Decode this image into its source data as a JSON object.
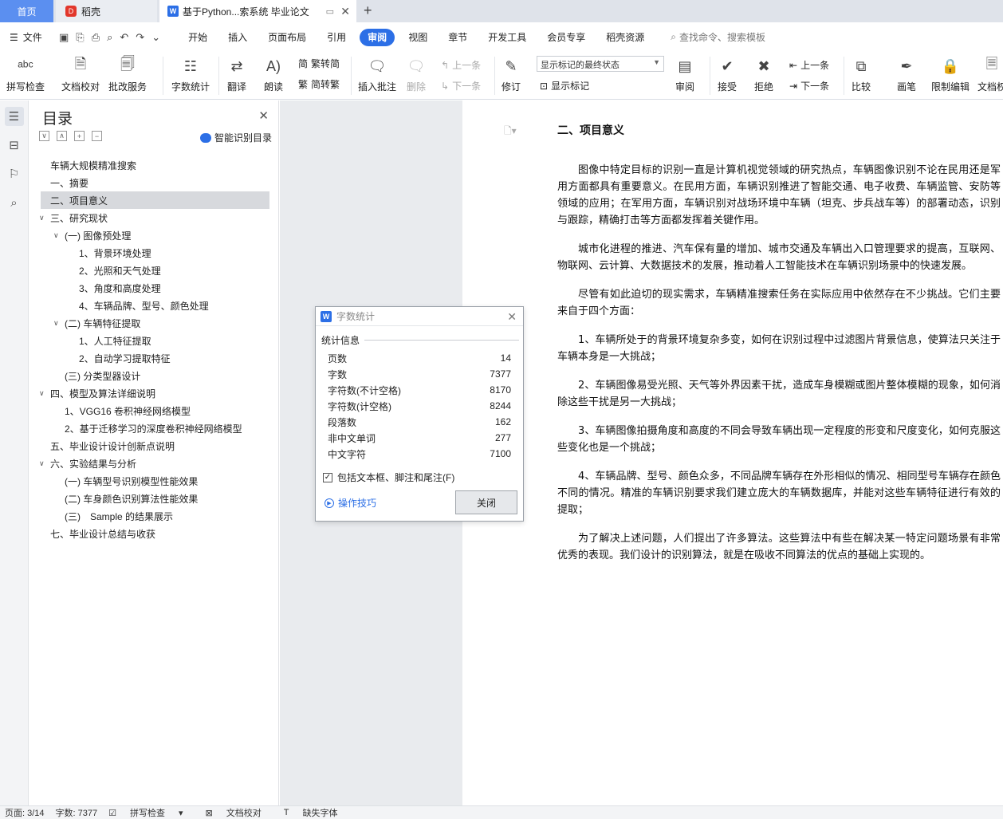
{
  "tabs": {
    "home": "首页",
    "daoke": "稻壳",
    "doc": "基于Python...索系统 毕业论文"
  },
  "menu": {
    "file": "文件",
    "items": [
      "开始",
      "插入",
      "页面布局",
      "引用",
      "审阅",
      "视图",
      "章节",
      "开发工具",
      "会员专享",
      "稻壳资源"
    ],
    "active_index": 4,
    "search": "查找命令、搜索模板"
  },
  "ribbon": {
    "spell_check": "拼写检查",
    "doc_proof": "文档校对",
    "batch_service": "批改服务",
    "word_count": "字数统计",
    "translate": "翻译",
    "read_aloud": "朗读",
    "trad_conv": "繁转简",
    "simp_conv": "简转繁",
    "insert_comment": "插入批注",
    "delete": "删除",
    "prev": "上一条",
    "next": "下一条",
    "revise": "修订",
    "markup_state": "显示标记的最终状态",
    "show_markup": "显示标记",
    "review": "审阅",
    "accept": "接受",
    "reject": "拒绝",
    "prev2": "上一条",
    "next2": "下一条",
    "compare": "比较",
    "pen": "画笔",
    "restrict_edit": "限制编辑",
    "doc_rights": "文档权"
  },
  "toc": {
    "title": "目录",
    "smart": "智能识别目录",
    "items": [
      {
        "text": "车辆大规模精准搜索",
        "level": 0,
        "chev": ""
      },
      {
        "text": "一、摘要",
        "level": 0,
        "chev": ""
      },
      {
        "text": "二、项目意义",
        "level": 0,
        "chev": "",
        "selected": true
      },
      {
        "text": "三、研究现状",
        "level": 0,
        "chev": "∨"
      },
      {
        "text": "(一) 图像预处理",
        "level": 1,
        "chev": "∨"
      },
      {
        "text": "1、背景环境处理",
        "level": 2,
        "chev": ""
      },
      {
        "text": "2、光照和天气处理",
        "level": 2,
        "chev": ""
      },
      {
        "text": "3、角度和高度处理",
        "level": 2,
        "chev": ""
      },
      {
        "text": "4、车辆品牌、型号、颜色处理",
        "level": 2,
        "chev": ""
      },
      {
        "text": "(二) 车辆特征提取",
        "level": 1,
        "chev": "∨"
      },
      {
        "text": "1、人工特征提取",
        "level": 2,
        "chev": ""
      },
      {
        "text": "2、自动学习提取特征",
        "level": 2,
        "chev": ""
      },
      {
        "text": "(三) 分类型器设计",
        "level": 1,
        "chev": ""
      },
      {
        "text": "四、模型及算法详细说明",
        "level": 0,
        "chev": "∨"
      },
      {
        "text": "1、VGG16 卷积神经网络模型",
        "level": 1,
        "chev": ""
      },
      {
        "text": "2、基于迁移学习的深度卷积神经网络模型",
        "level": 1,
        "chev": ""
      },
      {
        "text": "五、毕业设计设计创新点说明",
        "level": 0,
        "chev": ""
      },
      {
        "text": "六、实验结果与分析",
        "level": 0,
        "chev": "∨"
      },
      {
        "text": "(一) 车辆型号识别模型性能效果",
        "level": 1,
        "chev": ""
      },
      {
        "text": "(二) 车身颜色识别算法性能效果",
        "level": 1,
        "chev": ""
      },
      {
        "text": "(三)　Sample 的结果展示",
        "level": 1,
        "chev": ""
      },
      {
        "text": "七、毕业设计总结与收获",
        "level": 0,
        "chev": ""
      }
    ]
  },
  "dialog": {
    "title": "字数统计",
    "section": "统计信息",
    "stats": [
      {
        "label": "页数",
        "value": "14"
      },
      {
        "label": "字数",
        "value": "7377"
      },
      {
        "label": "字符数(不计空格)",
        "value": "8170"
      },
      {
        "label": "字符数(计空格)",
        "value": "8244"
      },
      {
        "label": "段落数",
        "value": "162"
      },
      {
        "label": "非中文单词",
        "value": "277"
      },
      {
        "label": "中文字符",
        "value": "7100"
      }
    ],
    "include_label": "包括文本框、脚注和尾注(F)",
    "include_checked": true,
    "tips": "操作技巧",
    "close": "关闭"
  },
  "document": {
    "heading": "二、项目意义",
    "paragraphs": [
      "图像中特定目标的识别一直是计算机视觉领域的研究热点，车辆图像识别不论在民用还是军用方面都具有重要意义。在民用方面，车辆识别推进了智能交通、电子收费、车辆监管、安防等领域的应用；在军用方面，车辆识别对战场环境中车辆（坦克、步兵战车等）的部署动态，识别与跟踪，精确打击等方面都发挥着关键作用。",
      "城市化进程的推进、汽车保有量的增加、城市交通及车辆出入口管理要求的提高，互联网、物联网、云计算、大数据技术的发展，推动着人工智能技术在车辆识别场景中的快速发展。",
      "尽管有如此迫切的现实需求，车辆精准搜索任务在实际应用中依然存在不少挑战。它们主要来自于四个方面：",
      "1、车辆所处于的背景环境复杂多变，如何在识别过程中过滤图片背景信息，使算法只关注于车辆本身是一大挑战；",
      "2、车辆图像易受光照、天气等外界因素干扰，造成车身模糊或图片整体模糊的现象，如何消除这些干扰是另一大挑战；",
      "3、车辆图像拍摄角度和高度的不同会导致车辆出现一定程度的形变和尺度变化，如何克服这些变化也是一个挑战；",
      "4、车辆品牌、型号、颜色众多，不同品牌车辆存在外形相似的情况、相同型号车辆存在颜色不同的情况。精准的车辆识别要求我们建立庞大的车辆数据库，并能对这些车辆特征进行有效的提取；",
      "为了解决上述问题，人们提出了许多算法。这些算法中有些在解决某一特定问题场景有非常优秀的表现。我们设计的识别算法，就是在吸收不同算法的优点的基础上实现的。"
    ]
  },
  "status": {
    "page": "页面: 3/14",
    "words": "字数: 7377",
    "spell": "拼写检查",
    "proof": "文档校对",
    "missing_font": "缺失字体"
  }
}
